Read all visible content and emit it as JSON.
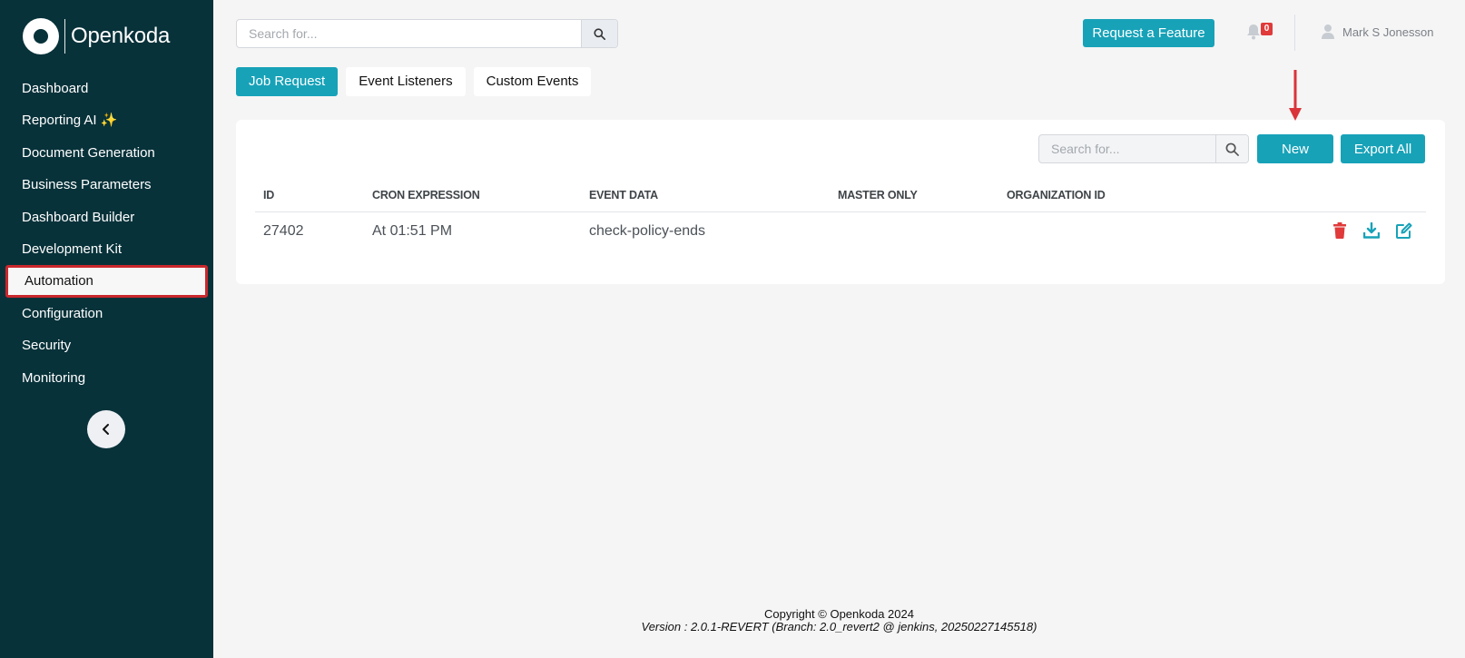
{
  "app": {
    "name": "Openkoda"
  },
  "sidebar": {
    "items": [
      {
        "label": "Dashboard"
      },
      {
        "label": "Reporting AI ✨"
      },
      {
        "label": "Document Generation"
      },
      {
        "label": "Business Parameters"
      },
      {
        "label": "Dashboard Builder"
      },
      {
        "label": "Development Kit"
      },
      {
        "label": "Automation",
        "active": true
      },
      {
        "label": "Configuration"
      },
      {
        "label": "Security"
      },
      {
        "label": "Monitoring"
      }
    ],
    "collapse_icon": "chevron-left-icon"
  },
  "topbar": {
    "search_placeholder": "Search for...",
    "feature_button": "Request a Feature",
    "notifications_count": "0",
    "user_name": "Mark S Jonesson"
  },
  "tabs": [
    {
      "label": "Job Request",
      "active": true
    },
    {
      "label": "Event Listeners"
    },
    {
      "label": "Custom Events"
    }
  ],
  "table": {
    "search_placeholder": "Search for...",
    "new_button": "New",
    "export_button": "Export All",
    "columns": [
      "ID",
      "CRON EXPRESSION",
      "EVENT DATA",
      "MASTER ONLY",
      "ORGANIZATION ID"
    ],
    "rows": [
      {
        "id": "27402",
        "cron": "At 01:51 PM",
        "event_data": "check-policy-ends",
        "master_only": "",
        "organization_id": ""
      }
    ],
    "row_action_icons": [
      "trash-icon",
      "download-icon",
      "edit-icon"
    ]
  },
  "colors": {
    "sidebar_bg": "#08323a",
    "accent": "#17a2b8",
    "danger": "#e03a3a",
    "highlight_border": "#c9282d"
  },
  "footer": {
    "copyright": "Copyright © Openkoda 2024",
    "version": "Version : 2.0.1-REVERT (Branch: 2.0_revert2 @ jenkins, 20250227145518)"
  }
}
